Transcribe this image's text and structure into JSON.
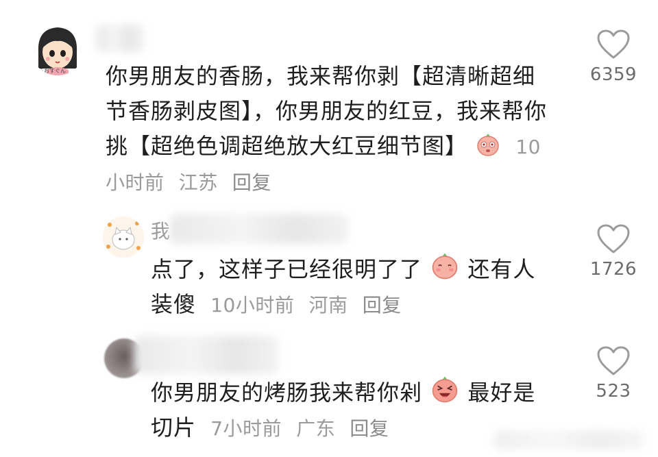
{
  "comments": [
    {
      "nickname": "",
      "avatar_caption": "ららおすぐん",
      "text": "你男朋友的香肠，我来帮你剥【超清晰超细节香肠剥皮图】，你男朋友的红豆，我来帮你挑【超绝色调超绝放大红豆细节图】",
      "time": "10小时前",
      "location": "江苏",
      "reply_label": "回复",
      "likes": "6359"
    },
    {
      "nickname": "我",
      "text": "点了，这样子已经很明了了",
      "text_after_emoji": "还有人装傻",
      "time": "10小时前",
      "location": "河南",
      "reply_label": "回复",
      "likes": "1726"
    },
    {
      "nickname": "",
      "text": "你男朋友的烤肠我来帮你剁",
      "text_after_emoji": "最好是切片",
      "time": "7小时前",
      "location": "广东",
      "reply_label": "回复",
      "likes": "523"
    }
  ],
  "icons": {
    "like": "heart-outline-icon",
    "emoji": "blush-emoji-icon"
  },
  "colors": {
    "text": "#1e1e1e",
    "meta": "#9a9a9a",
    "heart": "#9b9b9b",
    "emoji": "#f3a39a"
  }
}
